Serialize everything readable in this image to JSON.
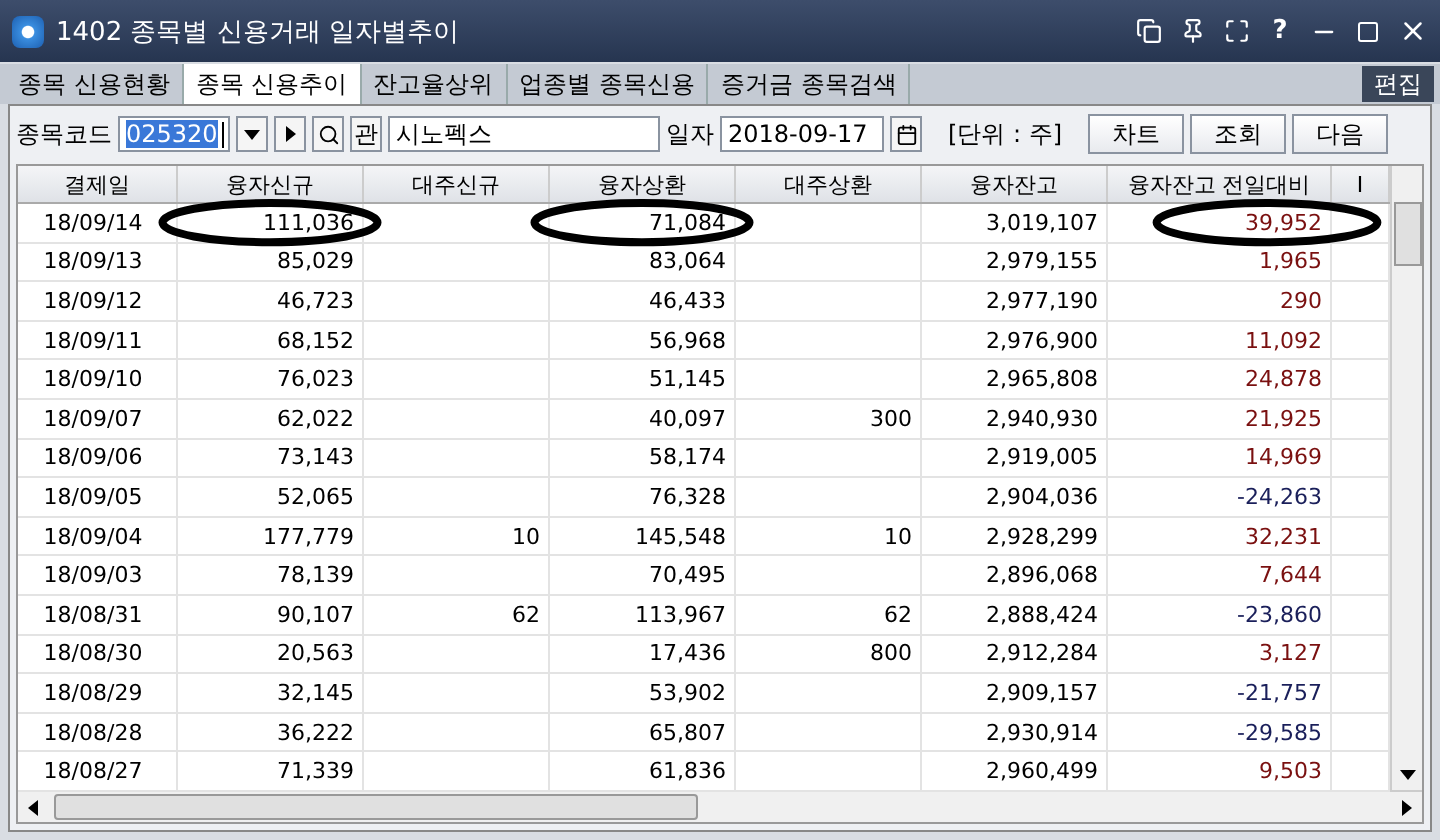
{
  "window": {
    "title": "1402 종목별 신용거래 일자별추이",
    "help": "?"
  },
  "tabs": [
    {
      "label": "종목 신용현황",
      "selected": false
    },
    {
      "label": "종목 신용추이",
      "selected": true
    },
    {
      "label": "잔고율상위",
      "selected": false
    },
    {
      "label": "업종별 종목신용",
      "selected": false
    },
    {
      "label": "증거금 종목검색",
      "selected": false
    }
  ],
  "edit_button": "편집",
  "toolbar": {
    "code_label": "종목코드",
    "code": "025320",
    "related_button": "관",
    "name": "시노펙스",
    "date_label": "일자",
    "date": "2018-09-17",
    "unit": "[단위 : 주]",
    "buttons": [
      "차트",
      "조회",
      "다음"
    ]
  },
  "table": {
    "columns": [
      "결제일",
      "융자신규",
      "대주신규",
      "융자상환",
      "대주상환",
      "융자잔고",
      "융자잔고 전일대비",
      "I"
    ],
    "rows": [
      {
        "cells": [
          "18/09/14",
          "111,036",
          "",
          "71,084",
          "",
          "3,019,107",
          "39,952"
        ],
        "kind": "up",
        "circled": true
      },
      {
        "cells": [
          "18/09/13",
          "85,029",
          "",
          "83,064",
          "",
          "2,979,155",
          "1,965"
        ],
        "kind": "up",
        "circled": false
      },
      {
        "cells": [
          "18/09/12",
          "46,723",
          "",
          "46,433",
          "",
          "2,977,190",
          "290"
        ],
        "kind": "up",
        "circled": false
      },
      {
        "cells": [
          "18/09/11",
          "68,152",
          "",
          "56,968",
          "",
          "2,976,900",
          "11,092"
        ],
        "kind": "up",
        "circled": false
      },
      {
        "cells": [
          "18/09/10",
          "76,023",
          "",
          "51,145",
          "",
          "2,965,808",
          "24,878"
        ],
        "kind": "up",
        "circled": false
      },
      {
        "cells": [
          "18/09/07",
          "62,022",
          "",
          "40,097",
          "300",
          "2,940,930",
          "21,925"
        ],
        "kind": "up",
        "circled": false
      },
      {
        "cells": [
          "18/09/06",
          "73,143",
          "",
          "58,174",
          "",
          "2,919,005",
          "14,969"
        ],
        "kind": "up",
        "circled": false
      },
      {
        "cells": [
          "18/09/05",
          "52,065",
          "",
          "76,328",
          "",
          "2,904,036",
          "-24,263"
        ],
        "kind": "down",
        "circled": false
      },
      {
        "cells": [
          "18/09/04",
          "177,779",
          "10",
          "145,548",
          "10",
          "2,928,299",
          "32,231"
        ],
        "kind": "up",
        "circled": false
      },
      {
        "cells": [
          "18/09/03",
          "78,139",
          "",
          "70,495",
          "",
          "2,896,068",
          "7,644"
        ],
        "kind": "up",
        "circled": false
      },
      {
        "cells": [
          "18/08/31",
          "90,107",
          "62",
          "113,967",
          "62",
          "2,888,424",
          "-23,860"
        ],
        "kind": "down",
        "circled": false
      },
      {
        "cells": [
          "18/08/30",
          "20,563",
          "",
          "17,436",
          "800",
          "2,912,284",
          "3,127"
        ],
        "kind": "up",
        "circled": false
      },
      {
        "cells": [
          "18/08/29",
          "32,145",
          "",
          "53,902",
          "",
          "2,909,157",
          "-21,757"
        ],
        "kind": "down",
        "circled": false
      },
      {
        "cells": [
          "18/08/28",
          "36,222",
          "",
          "65,807",
          "",
          "2,930,914",
          "-29,585"
        ],
        "kind": "down",
        "circled": false
      },
      {
        "cells": [
          "18/08/27",
          "71,339",
          "",
          "61,836",
          "",
          "2,960,499",
          "9,503"
        ],
        "kind": "up",
        "circled": false
      }
    ]
  }
}
